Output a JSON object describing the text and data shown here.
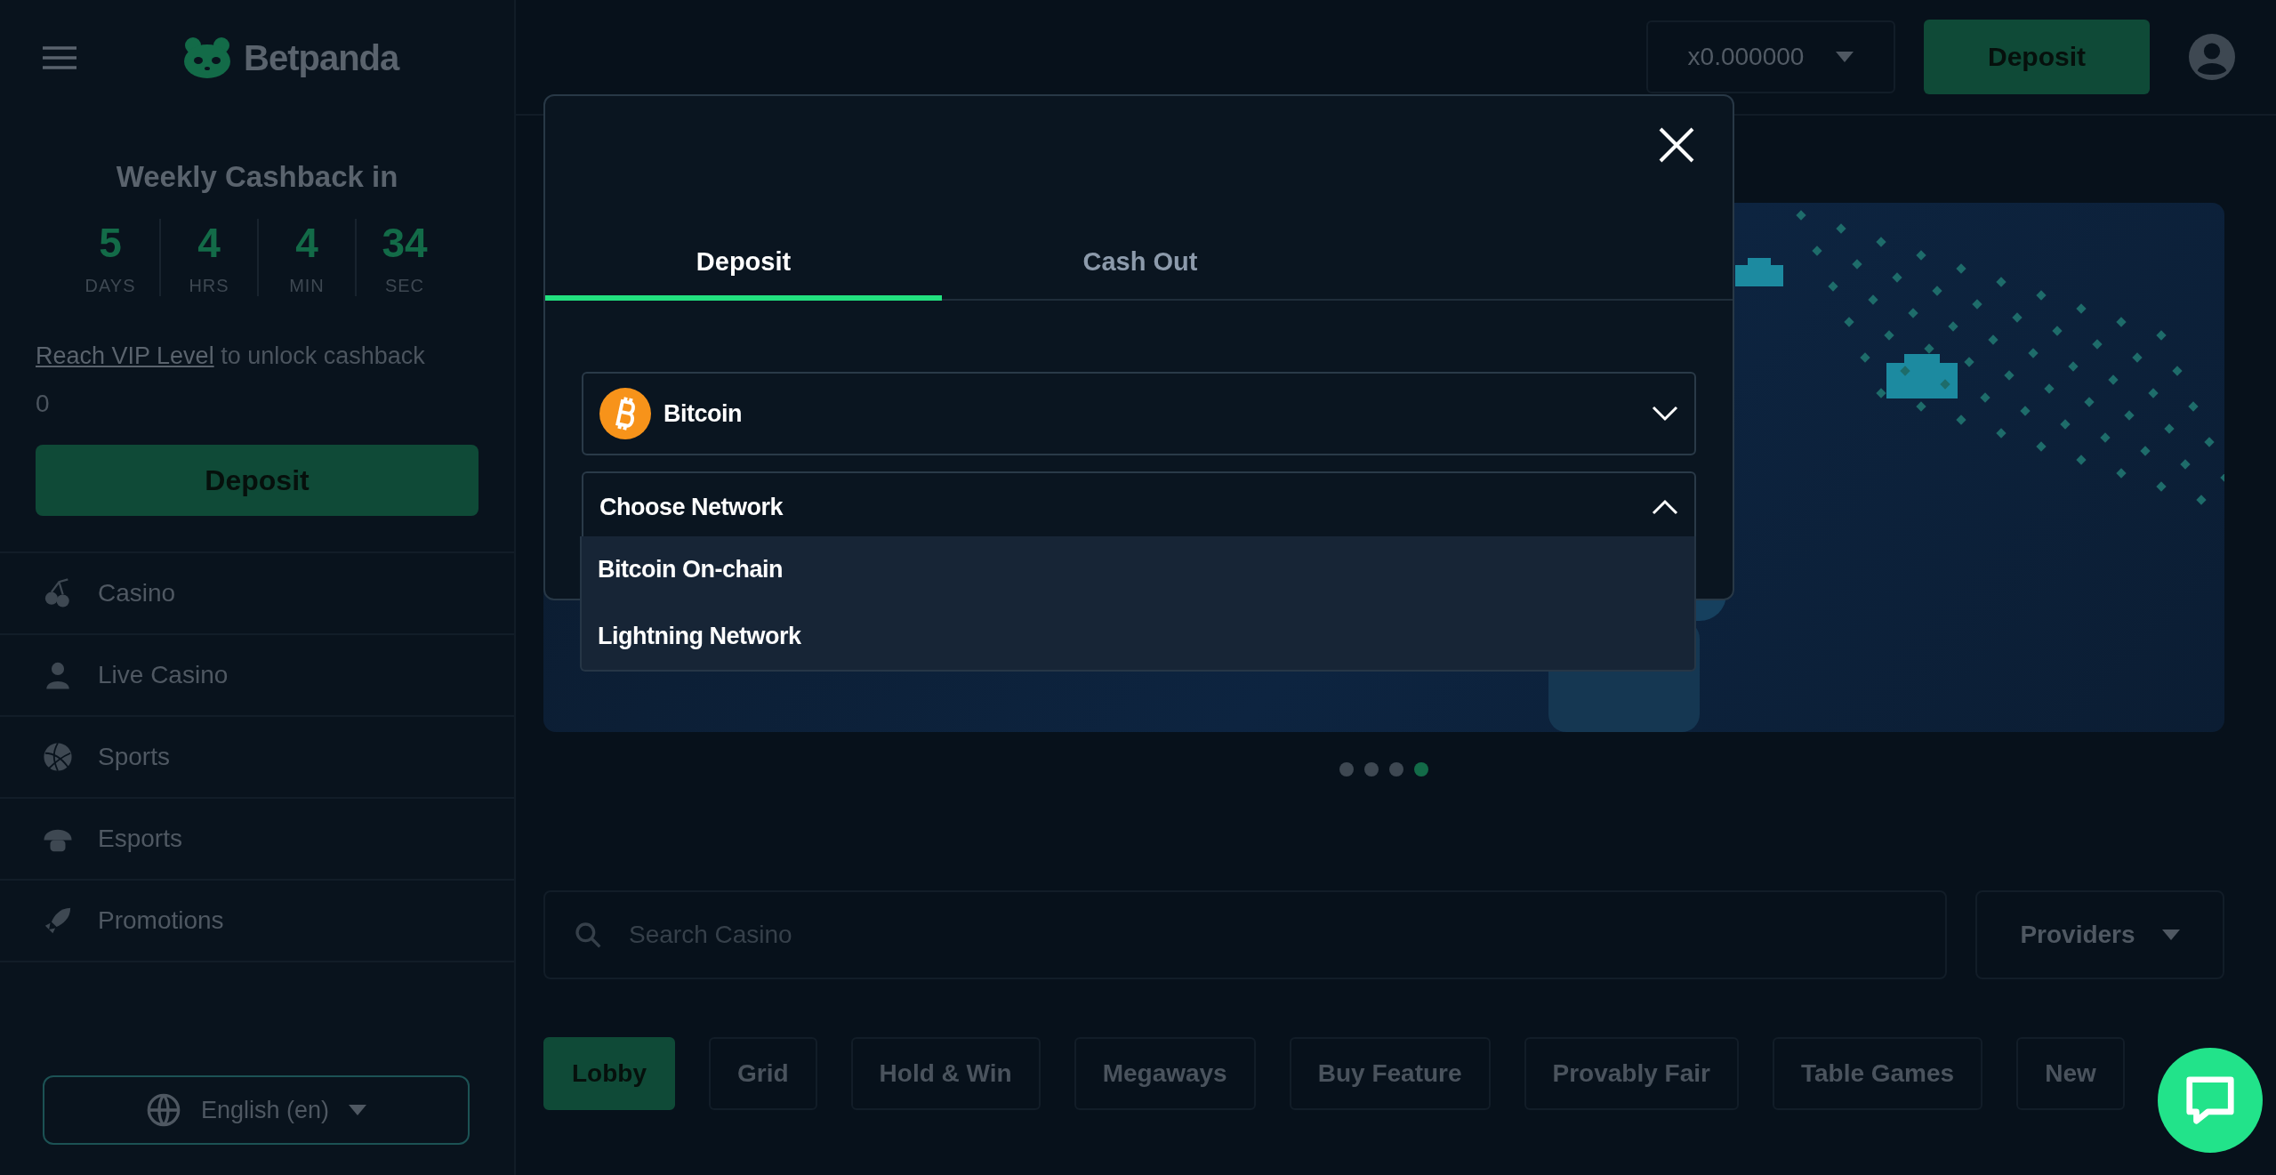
{
  "header": {
    "logo": "Betpanda",
    "balance": "x0.000000",
    "deposit_button": "Deposit"
  },
  "sidebar": {
    "cashback_title": "Weekly Cashback in",
    "countdown": [
      {
        "value": "5",
        "unit": "DAYS"
      },
      {
        "value": "4",
        "unit": "HRS"
      },
      {
        "value": "4",
        "unit": "MIN"
      },
      {
        "value": "34",
        "unit": "SEC"
      }
    ],
    "vip_link": "Reach VIP Level",
    "vip_text": "to unlock cashback",
    "cashback_amount": "0",
    "deposit_button": "Deposit",
    "nav_items": [
      {
        "label": "Casino"
      },
      {
        "label": "Live Casino"
      },
      {
        "label": "Sports"
      },
      {
        "label": "Esports"
      },
      {
        "label": "Promotions"
      }
    ],
    "language": "English (en)"
  },
  "banner": {
    "dots": [
      {
        "selected": false
      },
      {
        "selected": false
      },
      {
        "selected": false
      },
      {
        "selected": true
      }
    ]
  },
  "search": {
    "placeholder": "Search Casino"
  },
  "providers": "Providers",
  "categories": [
    {
      "label": "Lobby",
      "selected": true
    },
    {
      "label": "Grid",
      "selected": false
    },
    {
      "label": "Hold & Win",
      "selected": false
    },
    {
      "label": "Megaways",
      "selected": false
    },
    {
      "label": "Buy Feature",
      "selected": false
    },
    {
      "label": "Provably Fair",
      "selected": false
    },
    {
      "label": "Table Games",
      "selected": false
    },
    {
      "label": "New",
      "selected": false
    }
  ],
  "modal": {
    "tabs": [
      {
        "label": "Deposit",
        "selected": true
      },
      {
        "label": "Cash Out",
        "selected": false
      }
    ],
    "currency": {
      "value": "Bitcoin",
      "expanded": false
    },
    "network": {
      "placeholder": "Choose Network",
      "expanded": true,
      "options": [
        {
          "label": "Bitcoin On-chain"
        },
        {
          "label": "Lightning Network"
        }
      ]
    }
  }
}
